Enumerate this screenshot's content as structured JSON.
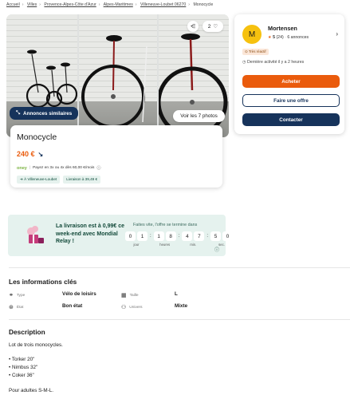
{
  "breadcrumb": [
    "Accueil",
    "Villes",
    "Provence-Alpes-Côte d'Azur",
    "Alpes-Maritimes",
    "Villeneuve-Loubet 06270",
    "Monocycle"
  ],
  "gallery": {
    "share_icon": "share-icon",
    "favorite_count": "2",
    "similar_label": "Annonces similaires",
    "photos_label": "Voir les 7 photos"
  },
  "listing": {
    "title": "Monocycle",
    "price": "240 €",
    "oney_brand": "oney",
    "oney_text": "Payez en 3x ou 4x dès 60,00 €/mois",
    "location_tag": "À Villeneuve-Loubet",
    "delivery_tag": "Livraison à 39,49 €"
  },
  "seller": {
    "avatar_letter": "M",
    "name": "Mortensen",
    "rating": "5",
    "reviews": "(24)",
    "ads": "6 annonces",
    "badge": "Très réactif",
    "activity": "Dernière activité il y a 2 heures",
    "buy_label": "Acheter",
    "offer_label": "Faire une offre",
    "contact_label": "Contacter"
  },
  "relay": {
    "headline": "La livraison est à 0,99€ ce week-end avec Mondial Relay !",
    "offer_line": "Faites vite, l'offre se termine dans",
    "countdown": [
      {
        "digits": [
          "0",
          "1"
        ],
        "label": "jour"
      },
      {
        "digits": [
          "1",
          "8"
        ],
        "label": "heures"
      },
      {
        "digits": [
          "4",
          "7"
        ],
        "label": "min."
      },
      {
        "digits": [
          "5",
          "0"
        ],
        "label": "sec."
      }
    ]
  },
  "info": {
    "heading": "Les informations clés",
    "rows": [
      {
        "label": "Type",
        "value": "Vélo de loisirs",
        "label2": "Taille",
        "value2": "L"
      },
      {
        "label": "État",
        "value": "Bon état",
        "label2": "Univers",
        "value2": "Mixte"
      }
    ]
  },
  "description": {
    "heading": "Description",
    "lines": [
      "Lot de trois monocycles.",
      "",
      "• Torker  20\"",
      "• Nimbus 32\"",
      "• Coker 36\"",
      "",
      "Pour adultes S-M-L."
    ]
  },
  "colors": {
    "accent": "#ea5b0c",
    "navy": "#16335b",
    "mint": "#e5f2ee"
  }
}
